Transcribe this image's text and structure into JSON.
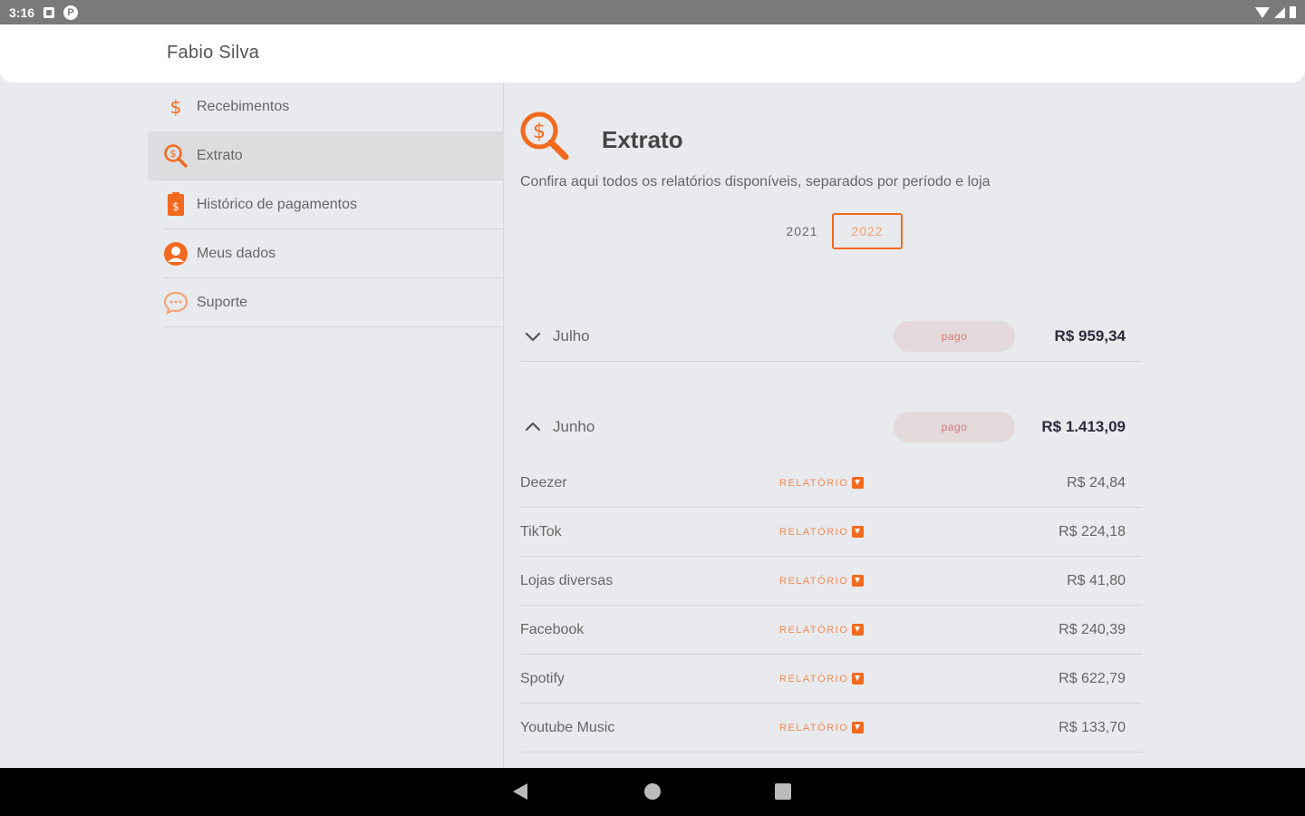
{
  "status_bar": {
    "time": "3:16",
    "notification_letter": "P"
  },
  "header": {
    "user_name": "Fabio Silva"
  },
  "sidebar": {
    "items": [
      {
        "label": "Recebimentos",
        "icon": "dollar-icon",
        "active": false
      },
      {
        "label": "Extrato",
        "icon": "search-dollar-icon",
        "active": true
      },
      {
        "label": "Histórico de pagamentos",
        "icon": "payment-history-icon",
        "active": false
      },
      {
        "label": "Meus dados",
        "icon": "user-icon",
        "active": false
      },
      {
        "label": "Suporte",
        "icon": "chat-bubble-icon",
        "active": false
      }
    ]
  },
  "main": {
    "title": "Extrato",
    "subtitle": "Confira aqui todos os relatórios disponíveis, separados por período e loja",
    "years": [
      "2021",
      "2022"
    ],
    "selected_year": "2022",
    "months": [
      {
        "name": "Julho",
        "status": "pago",
        "total": "R$ 959,34",
        "expanded": false
      },
      {
        "name": "Junho",
        "status": "pago",
        "total": "R$ 1.413,09",
        "expanded": true
      }
    ],
    "report_label": "RELATÓRIO",
    "stores": [
      {
        "name": "Deezer",
        "value": "R$ 24,84"
      },
      {
        "name": "TikTok",
        "value": "R$ 224,18"
      },
      {
        "name": "Lojas diversas",
        "value": "R$ 41,80"
      },
      {
        "name": "Facebook",
        "value": "R$ 240,39"
      },
      {
        "name": "Spotify",
        "value": "R$ 622,79"
      },
      {
        "name": "Youtube Music",
        "value": "R$ 133,70"
      }
    ]
  },
  "colors": {
    "accent": "#f26a1f",
    "background": "#e8eaed",
    "badge": "#e3d9db"
  }
}
